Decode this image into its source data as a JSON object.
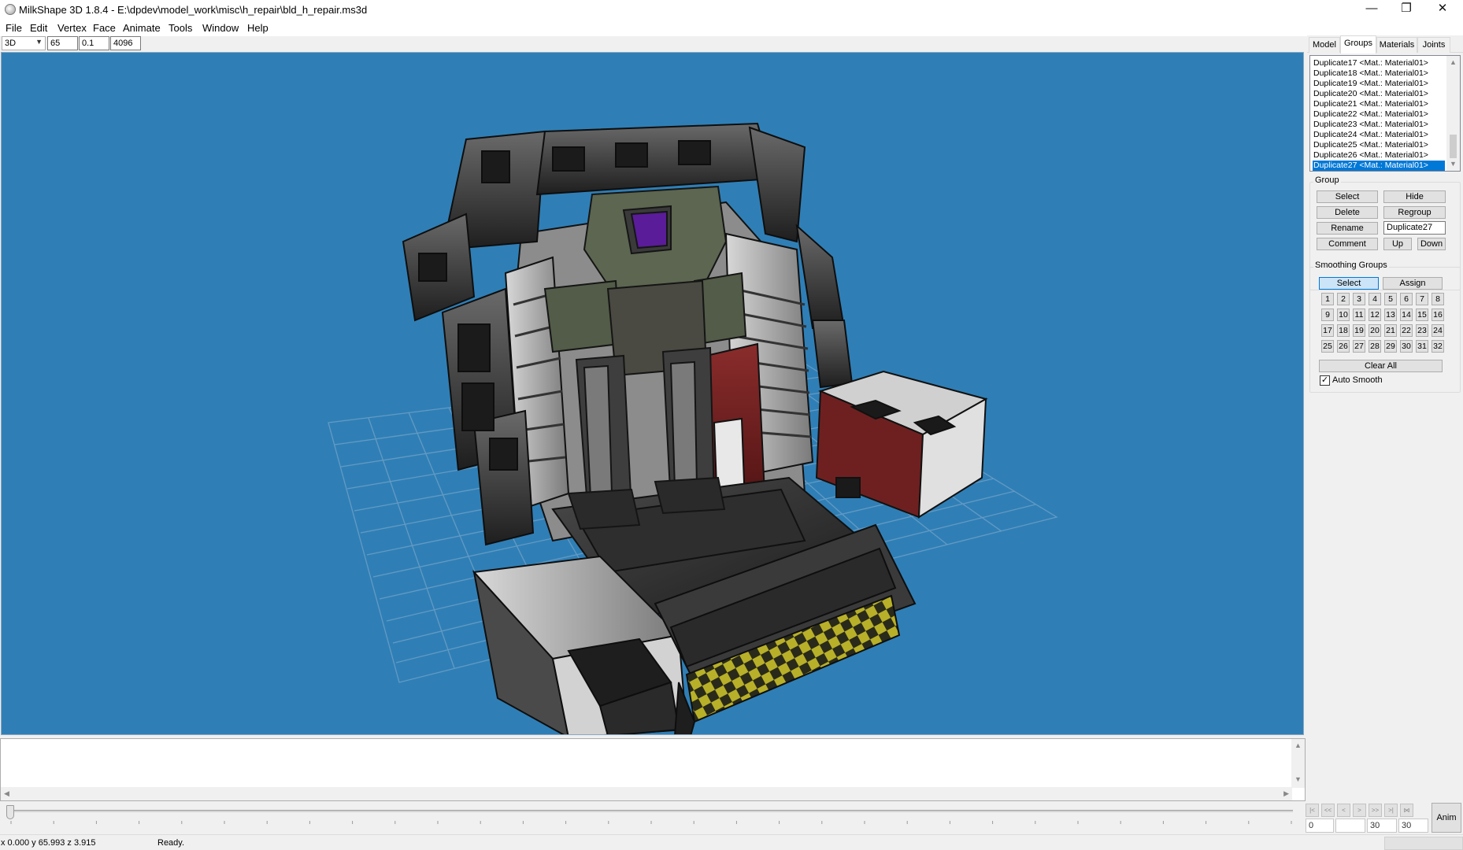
{
  "window": {
    "title": "MilkShape 3D 1.8.4 - E:\\dpdev\\model_work\\misc\\h_repair\\bld_h_repair.ms3d",
    "minimize_glyph": "—",
    "restore_glyph": "❐",
    "close_glyph": "✕"
  },
  "menu": [
    "File",
    "Edit",
    "Vertex",
    "Face",
    "Animate",
    "Tools",
    "Window",
    "Help"
  ],
  "view": {
    "mode": "3D",
    "field_fov": "65",
    "field_near": "0.1",
    "field_far": "4096"
  },
  "right_panel": {
    "tabs": [
      "Model",
      "Groups",
      "Materials",
      "Joints"
    ],
    "active_tab": "Groups",
    "group_list": [
      "Duplicate17 <Mat.: Material01>",
      "Duplicate18 <Mat.: Material01>",
      "Duplicate19 <Mat.: Material01>",
      "Duplicate20 <Mat.: Material01>",
      "Duplicate21 <Mat.: Material01>",
      "Duplicate22 <Mat.: Material01>",
      "Duplicate23 <Mat.: Material01>",
      "Duplicate24 <Mat.: Material01>",
      "Duplicate25 <Mat.: Material01>",
      "Duplicate26 <Mat.: Material01>",
      "Duplicate27 <Mat.: Material01>"
    ],
    "selected_group": "Duplicate27 <Mat.: Material01>",
    "group_box": {
      "label": "Group",
      "select": "Select",
      "hide": "Hide",
      "delete": "Delete",
      "regroup": "Regroup",
      "rename": "Rename",
      "rename_value": "Duplicate27",
      "comment": "Comment",
      "up": "Up",
      "down": "Down"
    },
    "smoothing": {
      "label": "Smoothing Groups",
      "select": "Select",
      "assign": "Assign",
      "groups": [
        "1",
        "2",
        "3",
        "4",
        "5",
        "6",
        "7",
        "8",
        "9",
        "10",
        "11",
        "12",
        "13",
        "14",
        "15",
        "16",
        "17",
        "18",
        "19",
        "20",
        "21",
        "22",
        "23",
        "24",
        "25",
        "26",
        "27",
        "28",
        "29",
        "30",
        "31",
        "32"
      ],
      "clear_all": "Clear All",
      "auto_smooth": "Auto Smooth",
      "auto_smooth_checked": true
    }
  },
  "timeline": {
    "nav_glyphs": [
      "|<",
      "<<",
      "<",
      ">",
      ">>",
      ">|",
      "⋈"
    ],
    "current_frame": "0",
    "start_value": "",
    "frame_a": "30",
    "frame_b": "30",
    "anim_button": "Anim"
  },
  "status": {
    "coords": "x 0.000 y 65.993 z 3.915",
    "message": "Ready."
  },
  "colors": {
    "viewport_bg": "#2f7fb6",
    "selection": "#0078d7"
  }
}
